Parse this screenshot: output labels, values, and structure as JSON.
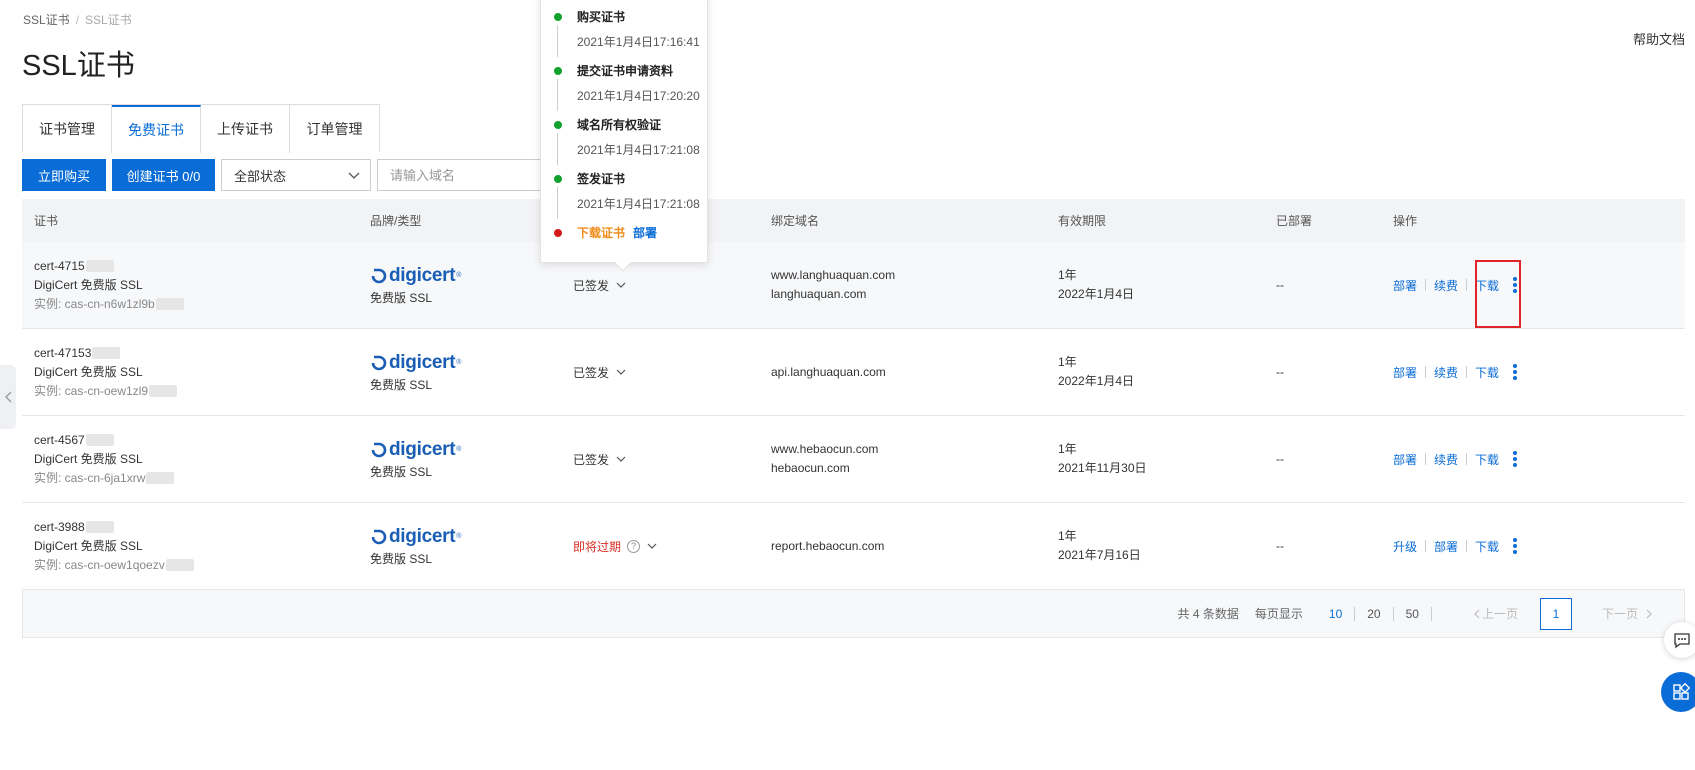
{
  "breadcrumb": {
    "root": "SSL证书",
    "separator": "/",
    "current": "SSL证书"
  },
  "page_title": "SSL证书",
  "help_link": "帮助文档",
  "tabs": [
    {
      "label": "证书管理"
    },
    {
      "label": "免费证书"
    },
    {
      "label": "上传证书"
    },
    {
      "label": "订单管理"
    }
  ],
  "active_tab": "免费证书",
  "toolbar": {
    "buy_label": "立即购买",
    "create_label": "创建证书 0/0",
    "status_select_value": "全部状态",
    "search_placeholder": "请输入域名"
  },
  "table": {
    "headers": {
      "cert": "证书",
      "brand": "品牌/类型",
      "status": "",
      "domain": "绑定域名",
      "valid": "有效期限",
      "deployed": "已部署",
      "ops": "操作"
    },
    "rows": [
      {
        "cert_id": "cert-4715",
        "cert_name": "DigiCert 免费版 SSL",
        "instance": "实例: cas-cn-n6w1zl9b",
        "brand_logo": "digicert",
        "brand_type": "免费版 SSL",
        "status": "已签发",
        "domain_1": "www.langhuaquan.com",
        "domain_2": "langhuaquan.com",
        "valid_period": "1年",
        "valid_until": "2022年1月4日",
        "deployed": "--",
        "op_1": "部署",
        "op_2": "续费",
        "op_3": "下载"
      },
      {
        "cert_id": "cert-47153",
        "cert_name": "DigiCert 免费版 SSL",
        "instance": "实例: cas-cn-oew1zl9",
        "brand_logo": "digicert",
        "brand_type": "免费版 SSL",
        "status": "已签发",
        "domain_1": "api.langhuaquan.com",
        "domain_2": "",
        "valid_period": "1年",
        "valid_until": "2022年1月4日",
        "deployed": "--",
        "op_1": "部署",
        "op_2": "续费",
        "op_3": "下载"
      },
      {
        "cert_id": "cert-4567",
        "cert_name": "DigiCert 免费版 SSL",
        "instance": "实例: cas-cn-6ja1xrw",
        "brand_logo": "digicert",
        "brand_type": "免费版 SSL",
        "status": "已签发",
        "domain_1": "www.hebaocun.com",
        "domain_2": "hebaocun.com",
        "valid_period": "1年",
        "valid_until": "2021年11月30日",
        "deployed": "--",
        "op_1": "部署",
        "op_2": "续费",
        "op_3": "下载"
      },
      {
        "cert_id": "cert-3988",
        "cert_name": "DigiCert 免费版 SSL",
        "instance": "实例: cas-cn-oew1qoezv",
        "brand_logo": "digicert",
        "brand_type": "免费版 SSL",
        "status": "即将过期",
        "domain_1": "report.hebaocun.com",
        "domain_2": "",
        "valid_period": "1年",
        "valid_until": "2021年7月16日",
        "deployed": "--",
        "op_1": "升级",
        "op_2": "部署",
        "op_3": "下载"
      }
    ]
  },
  "pager": {
    "total": "共 4 条数据",
    "per_page_label": "每页显示",
    "sizes": [
      "10",
      "20",
      "50"
    ],
    "active_size": "10",
    "prev": "上一页",
    "current_page": "1",
    "next": "下一页"
  },
  "popover": {
    "steps": [
      {
        "title": "购买证书",
        "time": "2021年1月4日17:16:41"
      },
      {
        "title": "提交证书申请资料",
        "time": "2021年1月4日17:20:20"
      },
      {
        "title": "域名所有权验证",
        "time": "2021年1月4日17:21:08"
      },
      {
        "title": "签发证书",
        "time": "2021年1月4日17:21:08"
      }
    ],
    "last_download": "下载证书",
    "last_deploy": "部署"
  },
  "brand": {
    "digicert_text": "digicert"
  },
  "colors": {
    "accent": "#0a6cd6",
    "warning": "#d93026",
    "success_dot": "#11a32d",
    "error_dot": "#d41a1a",
    "highlight_box": "#e0242b"
  }
}
